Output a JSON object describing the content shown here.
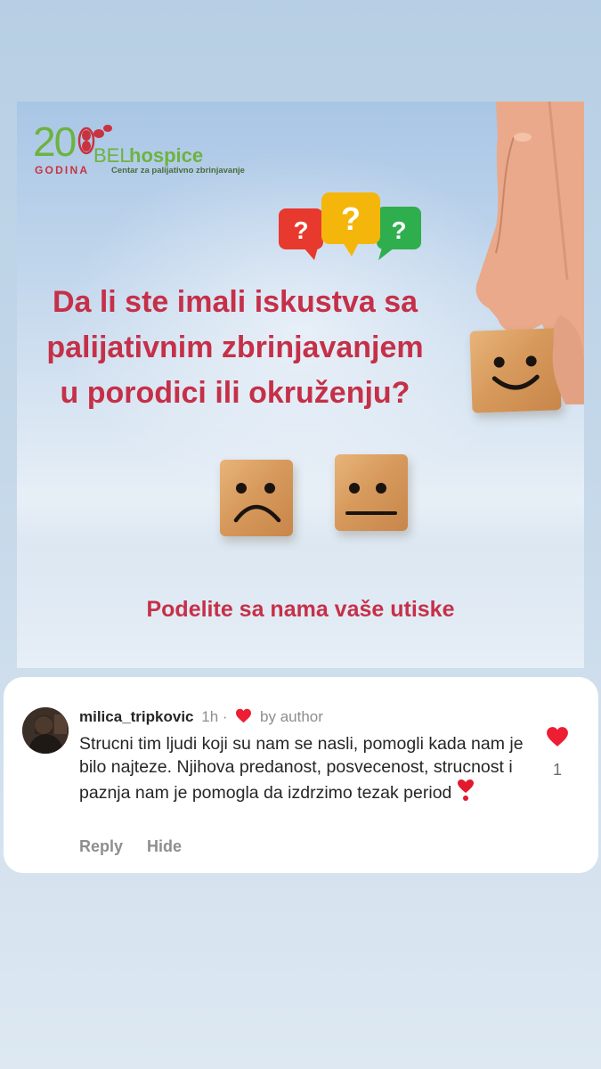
{
  "post": {
    "logo": {
      "number": "20",
      "godina": "GODINA",
      "bel": "BEL",
      "hospice": "hospice",
      "subtitle": "Centar za palijativno zbrinjavanje"
    },
    "bubbles": [
      "?",
      "?",
      "?"
    ],
    "headline_lines": [
      "Da li ste imali iskustva sa",
      "palijativnim zbrinjavanjem",
      "u porodici ili okruženju?"
    ],
    "cta": "Podelite sa nama vaše utiske",
    "colors": {
      "headline": "#c53048",
      "logo_green": "#6cb33f",
      "logo_red": "#c8333f"
    }
  },
  "comment": {
    "username": "milica_tripkovic",
    "time": "1h",
    "separator": "·",
    "liked_by": "by author",
    "text": "Strucni tim ljudi koji su nam se nasli, pomogli kada nam je bilo najteze. Njihova predanost, posvecenost, strucnost i paznja nam je pomogla da izdrzimo tezak period",
    "emoji": "heart-exclamation",
    "actions": {
      "reply": "Reply",
      "hide": "Hide"
    },
    "like_count": "1",
    "colors": {
      "heart": "#ed1d34"
    }
  }
}
